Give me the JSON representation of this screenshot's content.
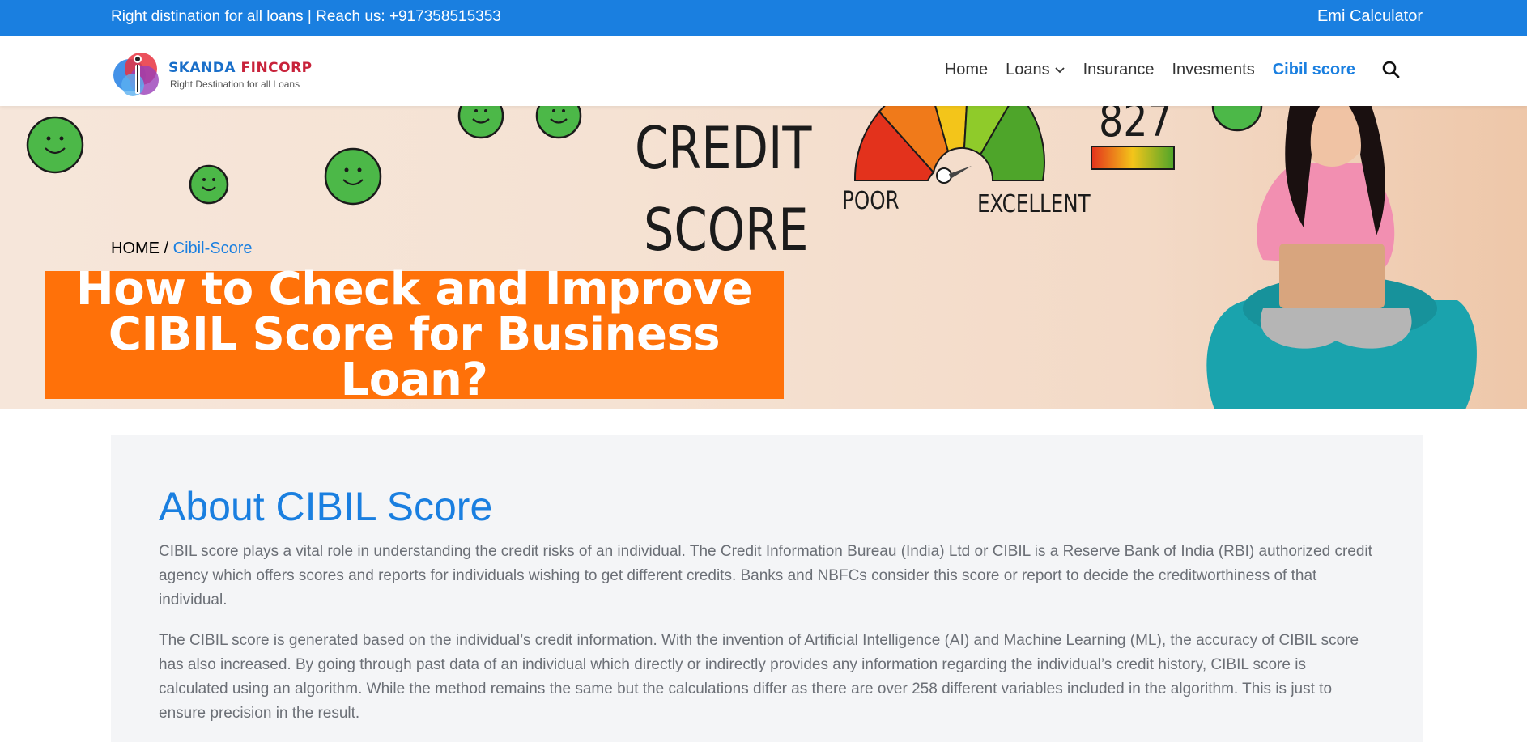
{
  "topbar": {
    "left_text": "Right distination for all loans | Reach us: +917358515353",
    "right_link": "Emi Calculator"
  },
  "header": {
    "logo_brand_part1": "SKANDA",
    "logo_brand_part2": "FINCORP",
    "logo_tagline": "Right Destination for all Loans",
    "nav": {
      "home": "Home",
      "loans": "Loans",
      "insurance": "Insurance",
      "investments": "Invesments",
      "cibil": "Cibil score"
    }
  },
  "hero": {
    "breadcrumb_home": "HOME",
    "breadcrumb_sep": " / ",
    "breadcrumb_current": "Cibil-Score",
    "title_line1": "How to Check and Improve",
    "title_line2": "CIBIL Score for Business Loan?",
    "image_text": {
      "credit": "CREDIT",
      "score": "SCORE",
      "poor": "POOR",
      "excellent": "EXCELLENT",
      "number": "827"
    }
  },
  "content": {
    "heading": "About CIBIL Score",
    "paragraph1": "CIBIL score plays a vital role in understanding the credit risks of an individual. The Credit Information Bureau (India) Ltd or CIBIL is a Reserve Bank of India (RBI) authorized credit agency which offers scores and reports for individuals wishing to get different credits. Banks and NBFCs consider this score or report to decide the creditworthiness of that individual.",
    "paragraph2": "The CIBIL score is generated based on the individual’s credit information. With the invention of Artificial Intelligence (AI) and Machine Learning (ML), the accuracy of CIBIL score has also increased. By going through past data of an individual which directly or indirectly provides any information regarding the individual’s credit history, CIBIL score is calculated using an algorithm. While the method remains the same but the calculations differ as there are over 258 different variables included in the algorithm. This is just to ensure precision in the result."
  },
  "colors": {
    "primary_blue": "#1a7fe0",
    "title_orange": "#ff7109",
    "content_bg": "#f4f5f7"
  }
}
